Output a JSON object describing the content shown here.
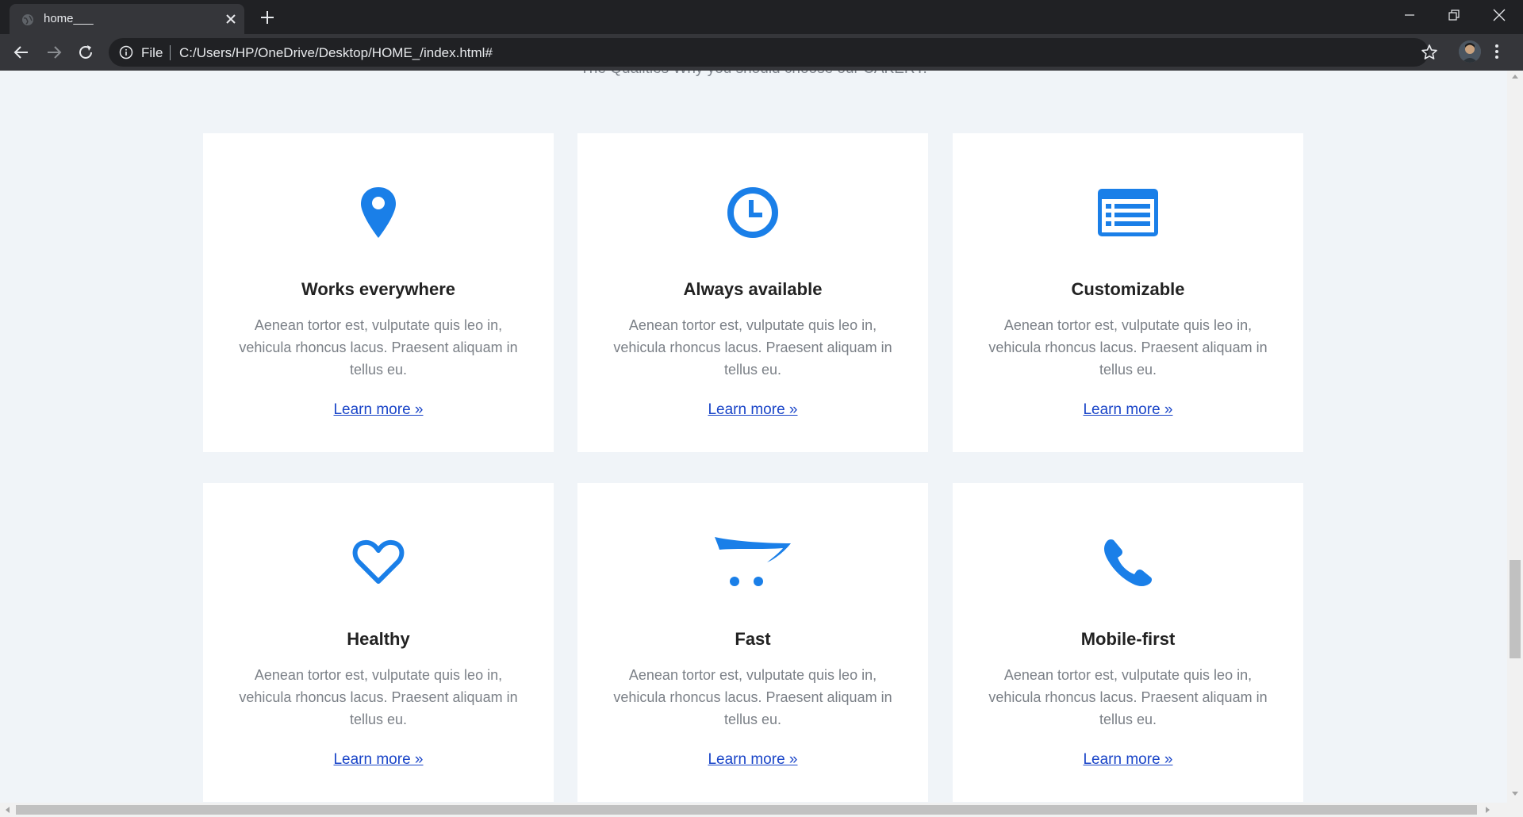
{
  "browser": {
    "tab_title": "home___",
    "scheme_label": "File",
    "url": "C:/Users/HP/OneDrive/Desktop/HOME_/index.html#"
  },
  "section": {
    "subtitle": "The Qualities Why you should choose our CAKERY."
  },
  "features": [
    {
      "icon": "map-pin-icon",
      "title": "Works everywhere",
      "description": "Aenean tortor est, vulputate quis leo in, vehicula rhoncus lacus. Praesent aliquam in tellus eu.",
      "link": "Learn more »"
    },
    {
      "icon": "clock-icon",
      "title": "Always available",
      "description": "Aenean tortor est, vulputate quis leo in, vehicula rhoncus lacus. Praesent aliquam in tellus eu.",
      "link": "Learn more »"
    },
    {
      "icon": "list-icon",
      "title": "Customizable",
      "description": "Aenean tortor est, vulputate quis leo in, vehicula rhoncus lacus. Praesent aliquam in tellus eu.",
      "link": "Learn more »"
    },
    {
      "icon": "heart-icon",
      "title": "Healthy",
      "description": "Aenean tortor est, vulputate quis leo in, vehicula rhoncus lacus. Praesent aliquam in tellus eu.",
      "link": "Learn more »"
    },
    {
      "icon": "cart-icon",
      "title": "Fast",
      "description": "Aenean tortor est, vulputate quis leo in, vehicula rhoncus lacus. Praesent aliquam in tellus eu.",
      "link": "Learn more »"
    },
    {
      "icon": "phone-icon",
      "title": "Mobile-first",
      "description": "Aenean tortor est, vulputate quis leo in, vehicula rhoncus lacus. Praesent aliquam in tellus eu.",
      "link": "Learn more »"
    }
  ],
  "colors": {
    "accent": "#1a7fe8",
    "link": "#1a45c8",
    "page_bg": "#f0f4f8",
    "chrome_dark": "#202124",
    "chrome_mid": "#35363a"
  }
}
